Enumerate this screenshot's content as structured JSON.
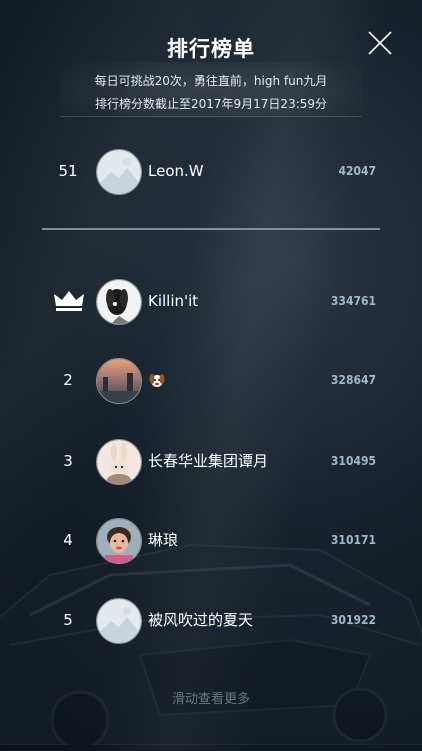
{
  "header": {
    "title": "排行榜单",
    "subtitle_line1": "每日可挑战20次，勇往直前，high fun九月",
    "subtitle_line2": "排行榜分数截止至2017年9月17日23:59分"
  },
  "my_rank": {
    "rank": "51",
    "name": "Leon.W",
    "score": "42047"
  },
  "leaderboard": [
    {
      "rank": "",
      "name": "Killin'it",
      "score": "334761",
      "avatar": "dog"
    },
    {
      "rank": "2",
      "name": "",
      "score": "328647",
      "avatar": "sunset"
    },
    {
      "rank": "3",
      "name": "长春华业集团谭月",
      "score": "310495",
      "avatar": "bunny"
    },
    {
      "rank": "4",
      "name": "琳琅",
      "score": "310171",
      "avatar": "child"
    },
    {
      "rank": "5",
      "name": "被风吹过的夏天",
      "score": "301922",
      "avatar": "default"
    }
  ],
  "footer": {
    "hint": "滑动查看更多"
  },
  "colors": {
    "score": "#9fb8c9",
    "text": "#ffffff"
  }
}
